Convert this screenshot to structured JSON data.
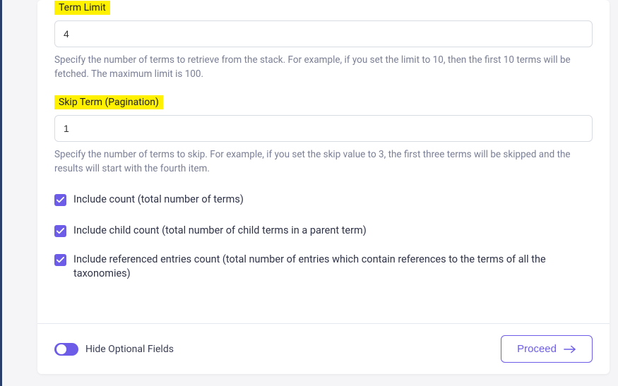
{
  "colors": {
    "accent": "#6c5ce7",
    "highlight": "#fff100"
  },
  "fields": {
    "termLimit": {
      "label": "Term Limit",
      "value": "4",
      "help": "Specify the number of terms to retrieve from the stack. For example, if you set the limit to 10, then the first 10 terms will be fetched. The maximum limit is 100."
    },
    "skipTerm": {
      "label": "Skip Term (Pagination)",
      "value": "1",
      "help": "Specify the number of terms to skip. For example, if you set the skip value to 3, the first three terms will be skipped and the results will start with the fourth item."
    }
  },
  "checkboxes": {
    "includeCount": {
      "label": "Include count (total number of terms)",
      "checked": true
    },
    "includeChildCount": {
      "label": "Include child count (total number of child terms in a parent term)",
      "checked": true
    },
    "includeRefEntries": {
      "label": "Include referenced entries count (total number of entries which contain references to the terms of all the taxonomies)",
      "checked": true
    }
  },
  "footer": {
    "toggleLabel": "Hide Optional Fields",
    "proceedLabel": "Proceed"
  }
}
